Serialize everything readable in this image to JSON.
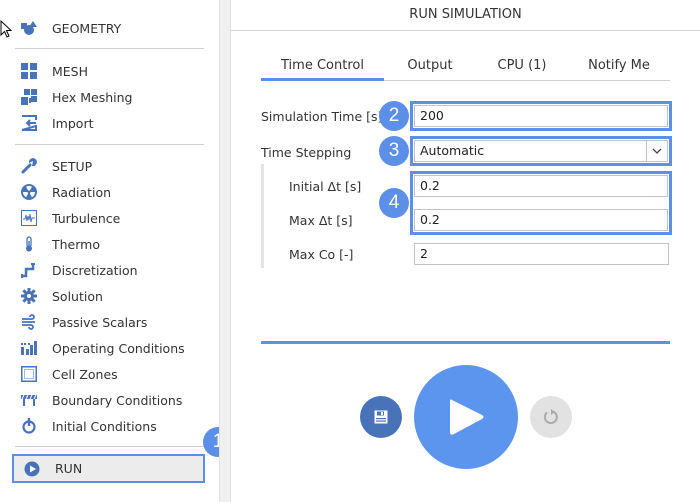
{
  "sidebar": {
    "items": [
      {
        "id": "geometry",
        "label": "GEOMETRY",
        "icon": "shapes-icon"
      },
      {
        "id": "mesh",
        "label": "MESH",
        "icon": "grid-icon"
      },
      {
        "id": "hex-meshing",
        "label": "Hex Meshing",
        "icon": "hex-mesh-icon"
      },
      {
        "id": "import",
        "label": "Import",
        "icon": "import-icon"
      },
      {
        "id": "setup",
        "label": "SETUP",
        "icon": "wrench-icon"
      },
      {
        "id": "radiation",
        "label": "Radiation",
        "icon": "radiation-icon"
      },
      {
        "id": "turbulence",
        "label": "Turbulence",
        "icon": "waveform-icon"
      },
      {
        "id": "thermo",
        "label": "Thermo",
        "icon": "thermometer-icon"
      },
      {
        "id": "discretization",
        "label": "Discretization",
        "icon": "pipe-icon"
      },
      {
        "id": "solution",
        "label": "Solution",
        "icon": "gear-icon"
      },
      {
        "id": "passive-scalars",
        "label": "Passive Scalars",
        "icon": "wind-icon"
      },
      {
        "id": "operating-conditions",
        "label": "Operating Conditions",
        "icon": "bar-chart-icon"
      },
      {
        "id": "cell-zones",
        "label": "Cell Zones",
        "icon": "dotted-square-icon"
      },
      {
        "id": "boundary-conditions",
        "label": "Boundary Conditions",
        "icon": "barrier-icon"
      },
      {
        "id": "initial-conditions",
        "label": "Initial Conditions",
        "icon": "power-icon"
      }
    ],
    "run": {
      "label": "RUN",
      "icon": "play-circle-icon"
    }
  },
  "badges": {
    "b1": "1",
    "b2": "2",
    "b3": "3",
    "b4": "4"
  },
  "main": {
    "title": "RUN SIMULATION",
    "tabs": [
      {
        "label": "Time Control",
        "active": true
      },
      {
        "label": "Output",
        "active": false
      },
      {
        "label": "CPU  (1)",
        "active": false
      },
      {
        "label": "Notify Me",
        "active": false
      }
    ],
    "form": {
      "simulation_time": {
        "label": "Simulation Time [s]",
        "value": "200"
      },
      "time_stepping": {
        "label": "Time Stepping",
        "value": "Automatic"
      },
      "initial_dt": {
        "label": "Initial Δt [s]",
        "value": "0.2"
      },
      "max_dt": {
        "label": "Max Δt [s]",
        "value": "0.2"
      },
      "max_co": {
        "label": "Max Co [-]",
        "value": "2"
      }
    },
    "buttons": {
      "save": "save-icon",
      "play": "play-icon",
      "reset": "reset-icon"
    }
  },
  "colors": {
    "accent": "#5b8fe8",
    "icon": "#4873b8",
    "reset_bg": "#e2e2e2"
  }
}
